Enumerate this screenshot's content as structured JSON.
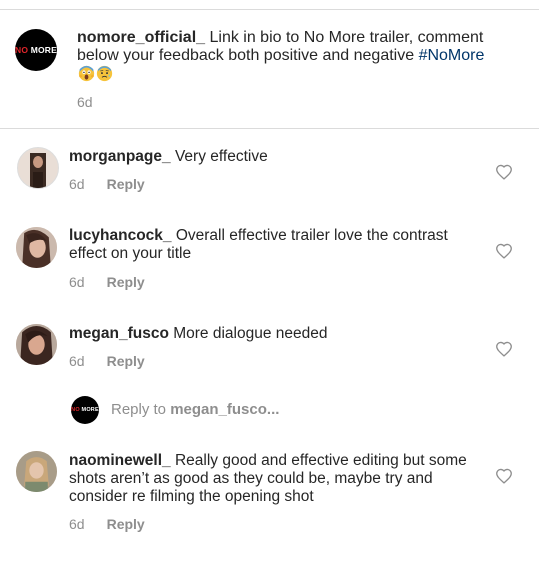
{
  "caption": {
    "username": "nomore_official_",
    "text": "Link in bio to No More trailer, comment below your feedback both positive and negative",
    "hashtag": "#NoMore",
    "time": "6d",
    "logo_no": "NO",
    "logo_more": "MORE"
  },
  "comments": [
    {
      "username": "morganpage_",
      "text": "Very effective",
      "time": "6d",
      "reply": "Reply"
    },
    {
      "username": "lucyhancock_",
      "text": "Overall effective trailer love the contrast effect on your title",
      "time": "6d",
      "reply": "Reply"
    },
    {
      "username": "megan_fusco",
      "text": "More dialogue needed",
      "time": "6d",
      "reply": "Reply"
    },
    {
      "username": "naominewell_",
      "text": "Really good and effective editing but some shots aren’t as good as they could be, maybe try and consider re filming the opening shot",
      "time": "6d",
      "reply": "Reply"
    }
  ],
  "reply_prompt": {
    "prefix": "Reply to",
    "target": "megan_fusco..."
  },
  "icons": {
    "like": "heart-outline-icon",
    "emoji_1": "screaming-face-emoji",
    "emoji_2": "anxious-face-emoji"
  },
  "colors": {
    "hashtag": "#003569",
    "secondary_text": "#8e8e8e",
    "divider": "#dbdbdb",
    "logo_red": "#e0252b"
  }
}
